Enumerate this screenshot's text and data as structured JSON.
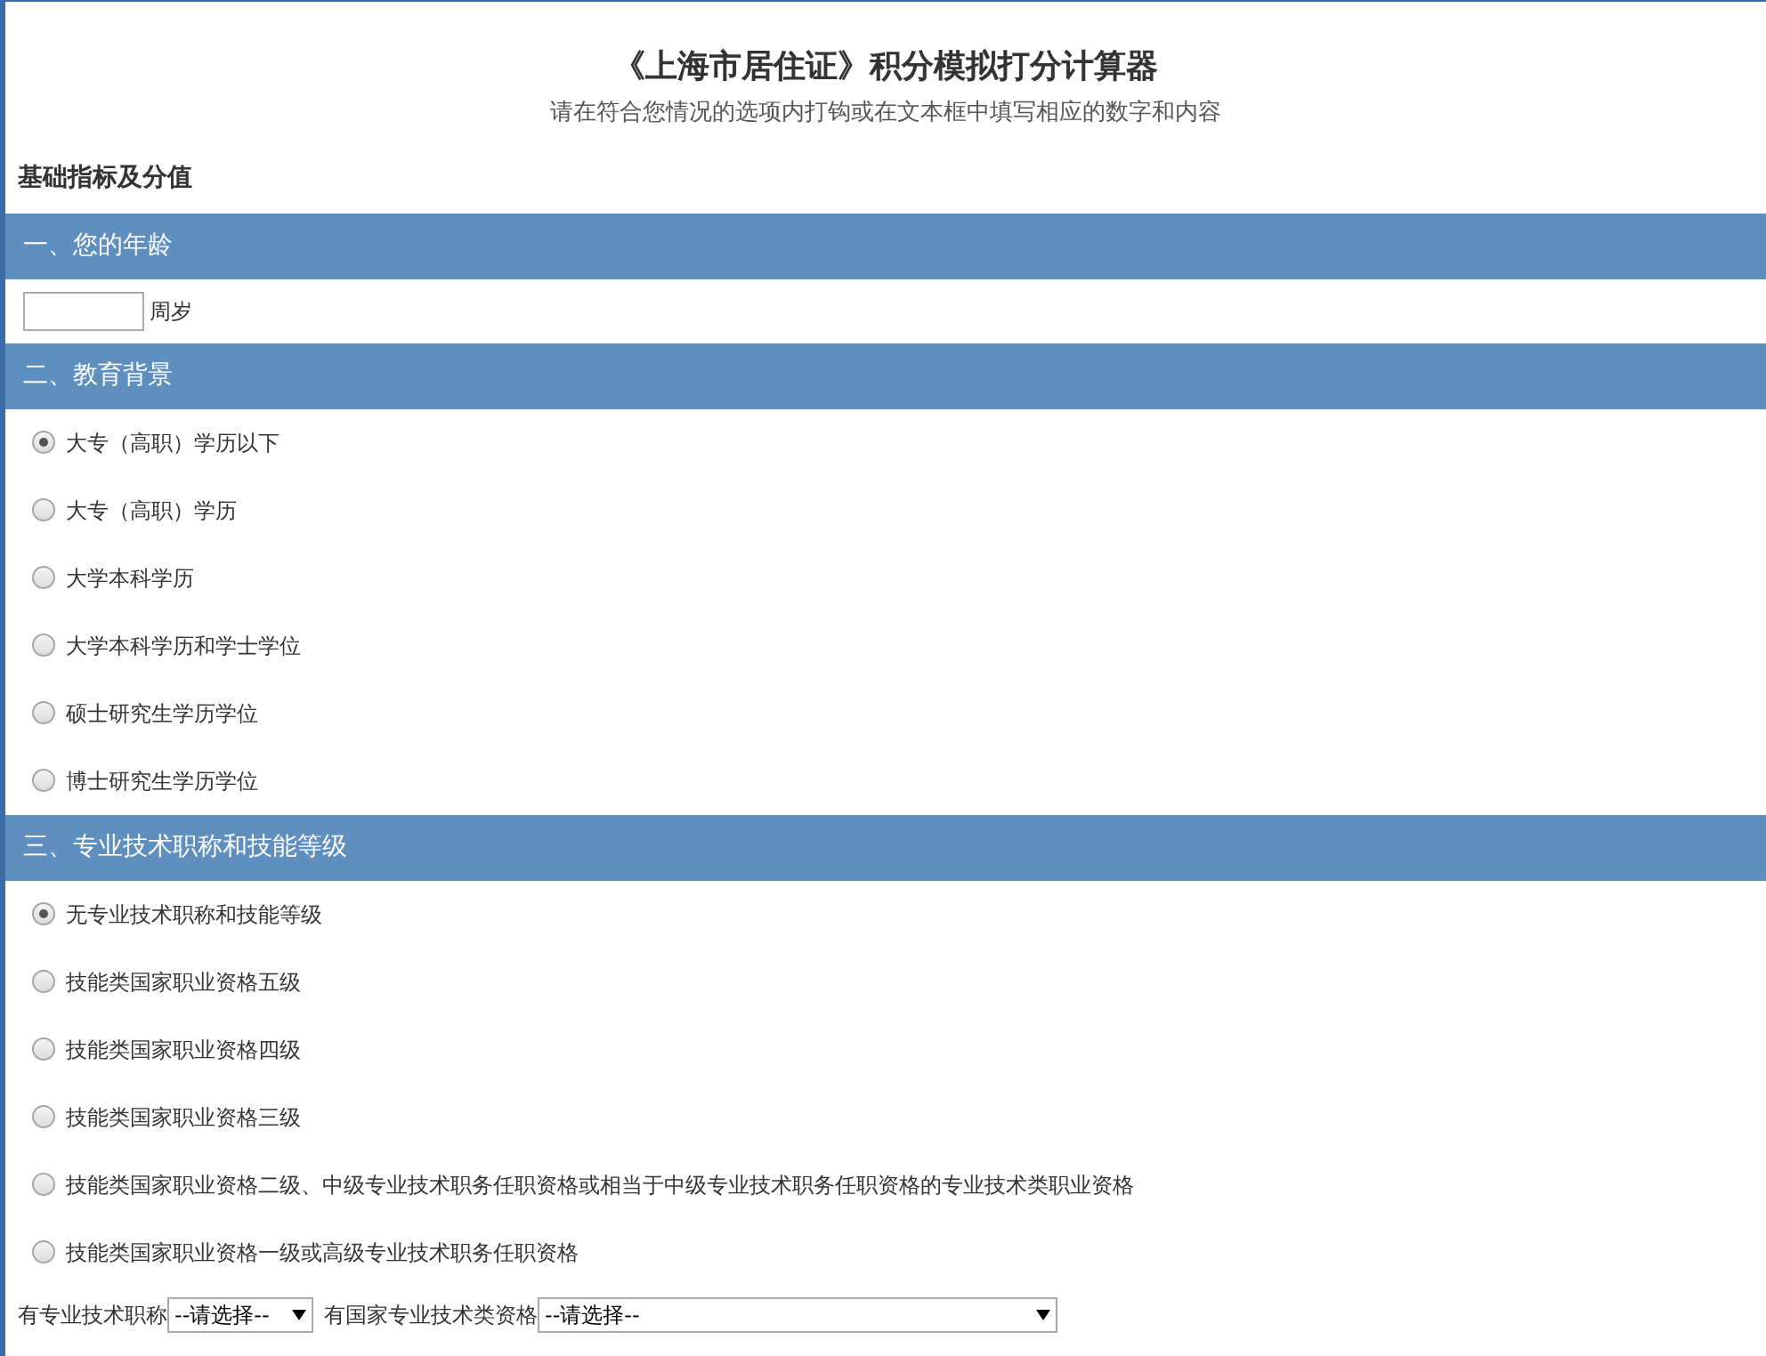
{
  "title": "《上海市居住证》积分模拟打分计算器",
  "subtitle": "请在符合您情况的选项内打钩或在文本框中填写相应的数字和内容",
  "section_heading": "基础指标及分值",
  "sections": [
    {
      "kind": "age",
      "title": "一、您的年龄",
      "unit": "周岁"
    },
    {
      "kind": "radios",
      "title": "二、教育背景",
      "options": [
        {
          "label": "大专（高职）学历以下",
          "selected": true
        },
        {
          "label": "大专（高职）学历",
          "selected": false
        },
        {
          "label": "大学本科学历",
          "selected": false
        },
        {
          "label": "大学本科学历和学士学位",
          "selected": false
        },
        {
          "label": "硕士研究生学历学位",
          "selected": false
        },
        {
          "label": "博士研究生学历学位",
          "selected": false
        }
      ]
    },
    {
      "kind": "radios",
      "title": "三、专业技术职称和技能等级",
      "options": [
        {
          "label": "无专业技术职称和技能等级",
          "selected": true
        },
        {
          "label": "技能类国家职业资格五级",
          "selected": false
        },
        {
          "label": "技能类国家职业资格四级",
          "selected": false
        },
        {
          "label": "技能类国家职业资格三级",
          "selected": false
        },
        {
          "label": "技能类国家职业资格二级、中级专业技术职务任职资格或相当于中级专业技术职务任职资格的专业技术类职业资格",
          "selected": false
        },
        {
          "label": "技能类国家职业资格一级或高级专业技术职务任职资格",
          "selected": false
        }
      ]
    }
  ],
  "selects": [
    {
      "label": "有专业技术职称",
      "value": "--请选择--"
    },
    {
      "label": "有国家专业技术类资格",
      "value": "--请选择--"
    }
  ]
}
